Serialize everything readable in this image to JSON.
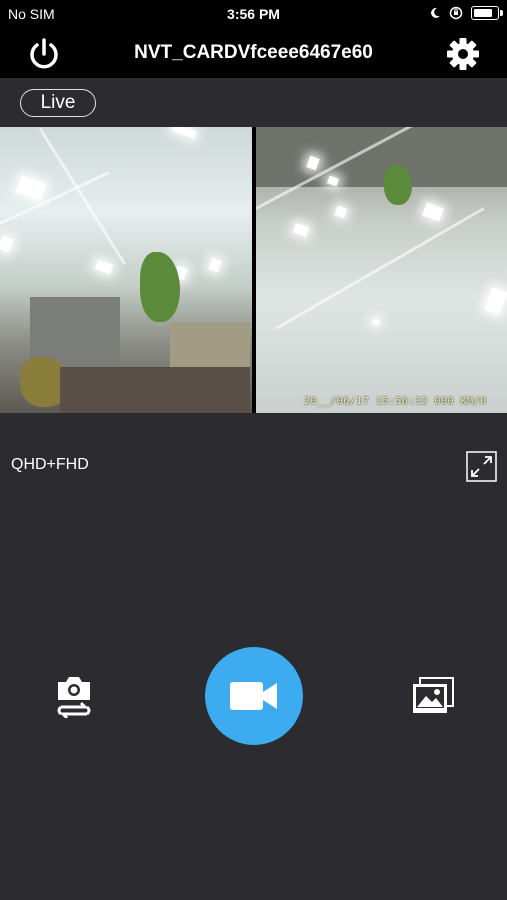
{
  "status_bar": {
    "carrier": "No SIM",
    "time": "3:56 PM",
    "battery_level": 0.9,
    "icons": [
      "moon-icon",
      "orientation-lock-icon",
      "battery-icon"
    ]
  },
  "header": {
    "title": "NVT_CARDVfceee6467e60",
    "left_icon": "power-icon",
    "right_icon": "gear-icon"
  },
  "live_badge": "Live",
  "video": {
    "front_camera": "front-camera-view",
    "rear_camera": "rear-camera-view",
    "osd_text": "20__/06/17 15:56:32  000 KM/H"
  },
  "resolution": "QHD+FHD",
  "controls": {
    "fullscreen_icon": "fullscreen-icon",
    "photo_icon": "camera-switch-icon",
    "record_icon": "video-camera-icon",
    "gallery_icon": "gallery-icon",
    "accent_color": "#3cabef"
  },
  "colors": {
    "background": "#2c2c30",
    "header": "#000000",
    "text": "#ffffff"
  }
}
